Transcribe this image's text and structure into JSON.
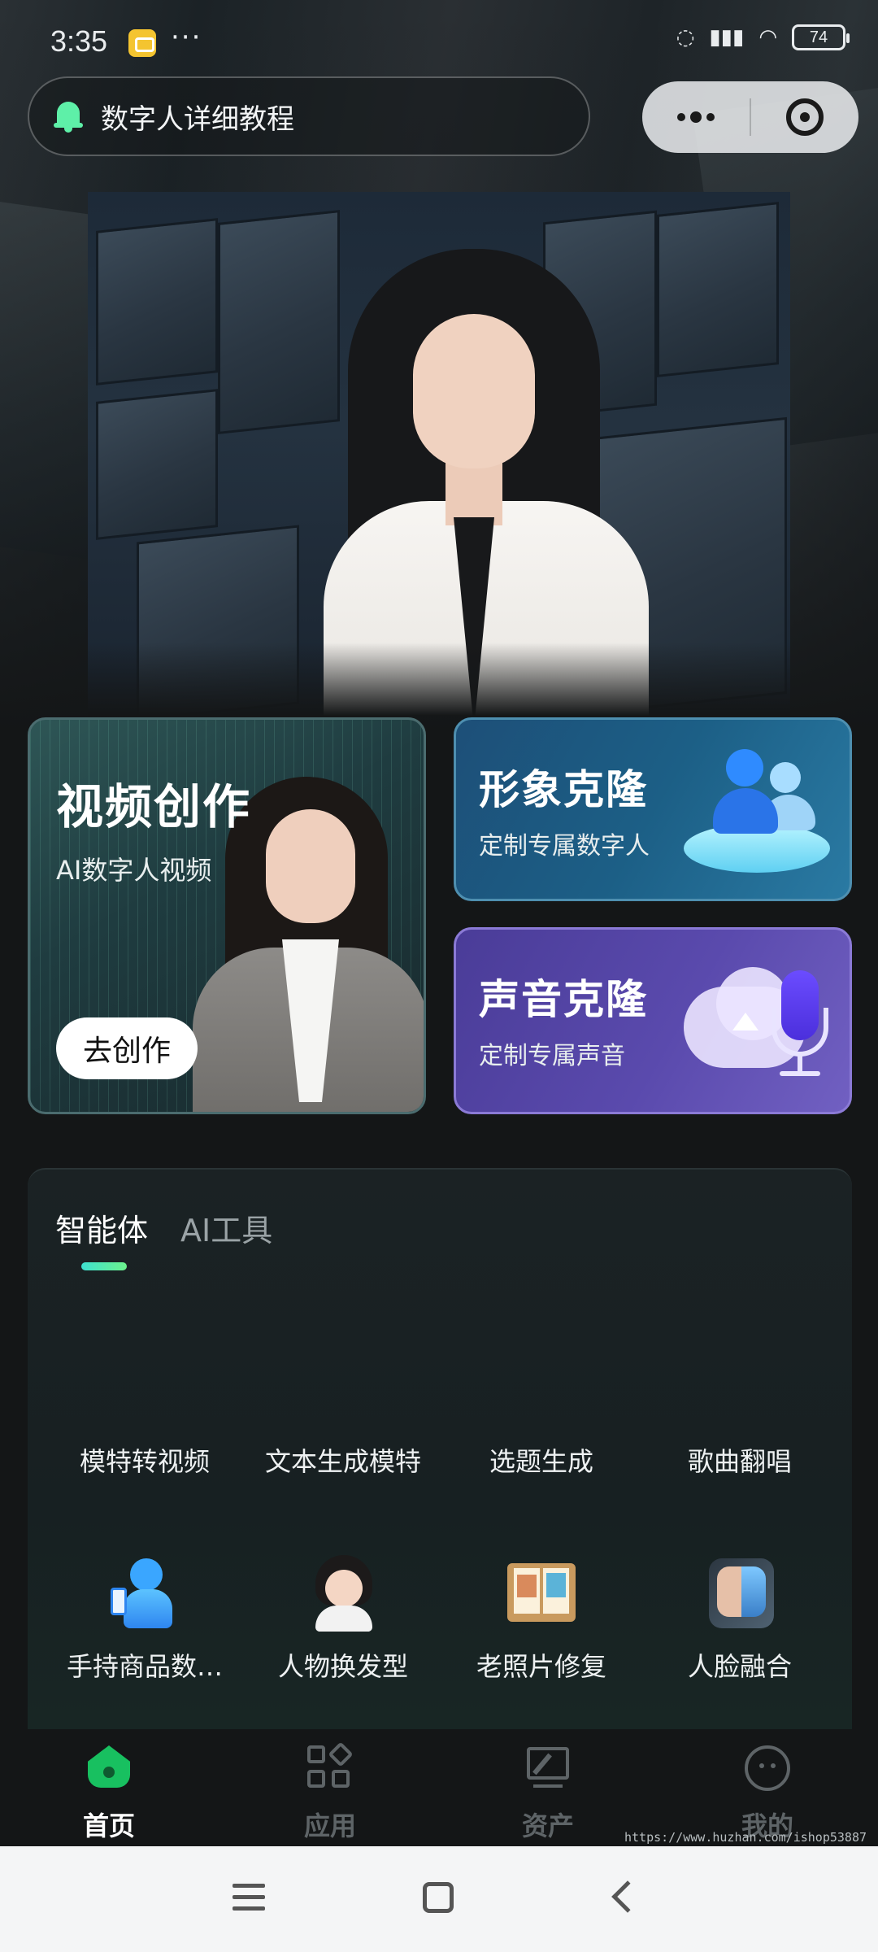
{
  "status_bar": {
    "time": "3:35",
    "dots": "···",
    "battery": "74"
  },
  "notice": {
    "text": "数字人详细教程"
  },
  "features": {
    "video": {
      "title": "视频创作",
      "subtitle": "AI数字人视频",
      "button": "去创作"
    },
    "avatar_clone": {
      "title": "形象克隆",
      "subtitle": "定制专属数字人"
    },
    "voice_clone": {
      "title": "声音克隆",
      "subtitle": "定制专属声音"
    }
  },
  "tools_panel": {
    "tabs": [
      {
        "label": "智能体"
      },
      {
        "label": "AI工具"
      }
    ],
    "row1": [
      {
        "label": "模特转视频"
      },
      {
        "label": "文本生成模特"
      },
      {
        "label": "选题生成"
      },
      {
        "label": "歌曲翻唱"
      }
    ],
    "row2": [
      {
        "label": "手持商品数…",
        "icon": "robot-holding-phone-icon"
      },
      {
        "label": "人物换发型",
        "icon": "girl-hairstyle-icon"
      },
      {
        "label": "老照片修复",
        "icon": "photo-album-icon"
      },
      {
        "label": "人脸融合",
        "icon": "face-fusion-icon"
      }
    ]
  },
  "bottom_nav": {
    "items": [
      {
        "label": "首页",
        "icon": "home-icon",
        "active": true
      },
      {
        "label": "应用",
        "icon": "apps-icon",
        "active": false
      },
      {
        "label": "资产",
        "icon": "asset-icon",
        "active": false
      },
      {
        "label": "我的",
        "icon": "profile-icon",
        "active": false
      }
    ]
  },
  "watermark": "https://www.huzhan.com/ishop53887",
  "colors": {
    "accent_green": "#18c060",
    "video_card": "#1f3c40",
    "avatar_card": "#1c5f86",
    "voice_card": "#5a4aad"
  }
}
